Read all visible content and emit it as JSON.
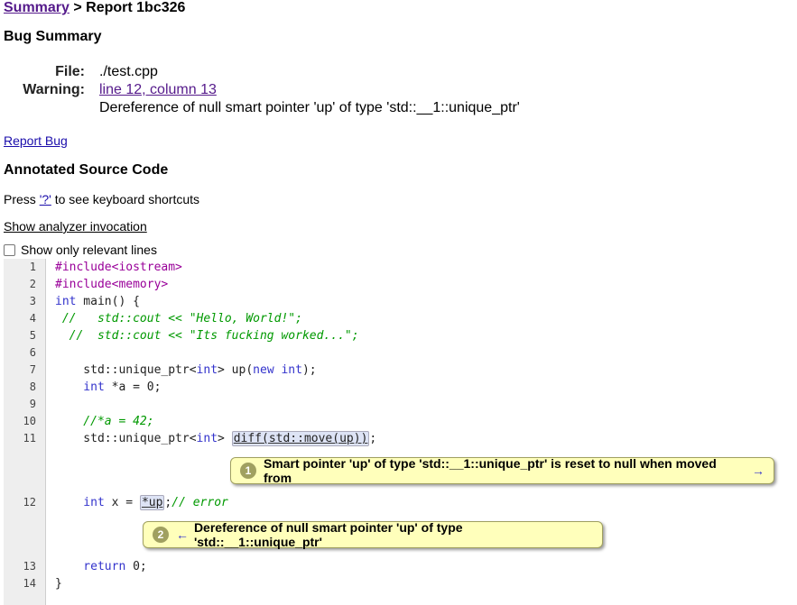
{
  "breadcrumb": {
    "summary_link": "Summary",
    "sep": " > ",
    "report": "Report 1bc326"
  },
  "bug_summary": {
    "heading": "Bug Summary",
    "file_label": "File:",
    "file_value": "./test.cpp",
    "warning_label": "Warning:",
    "warning_link": "line 12, column 13",
    "warning_text": "Dereference of null smart pointer 'up' of type 'std::__1::unique_ptr'"
  },
  "report_bug": "Report Bug",
  "annotated": {
    "heading": "Annotated Source Code",
    "press_pre": "Press ",
    "press_key": "'?'",
    "press_post": " to see keyboard shortcuts",
    "show_invocation": "Show analyzer invocation",
    "relevant_only": "Show only relevant lines"
  },
  "code": {
    "line_numbers": [
      "1",
      "2",
      "3",
      "4",
      "5",
      "6",
      "7",
      "8",
      "9",
      "10",
      "11",
      "12",
      "13",
      "14"
    ],
    "l1_pp": "#include<iostream>",
    "l2_pp": "#include<memory>",
    "l3_kw": "int",
    "l3_rest": " main() {",
    "l4_cm": " //   std::cout << ",
    "l4_str": "\"Hello, World!\";",
    "l5_cm": "  //  std::cout << ",
    "l5_str": "\"Its fucking worked...\";",
    "l7_a": "    std::unique_ptr<",
    "l7_kw1": "int",
    "l7_b": "> up(",
    "l7_kw2": "new int",
    "l7_c": ");",
    "l8_kw": "    int",
    "l8_rest": " *a = 0;",
    "l10_cm": "    //*a = 42;",
    "l11_a": "    std::unique_ptr<",
    "l11_kw": "int",
    "l11_b": "> ",
    "l11_hl": "diff(std::move(up))",
    "l11_c": ";",
    "l12_kw": "    int",
    "l12_a": " x = ",
    "l12_hl": "*up",
    "l12_b": ";",
    "l12_cm": "// error",
    "l13_kw": "    return",
    "l13_rest": " 0;",
    "l14": "}"
  },
  "notes": [
    {
      "num": "1",
      "text": "Smart pointer 'up' of type 'std::__1::unique_ptr' is reset to null when moved from",
      "arrow": "→"
    },
    {
      "num": "2",
      "arrow": "←",
      "text": "Dereference of null smart pointer 'up' of type 'std::__1::unique_ptr'"
    }
  ]
}
